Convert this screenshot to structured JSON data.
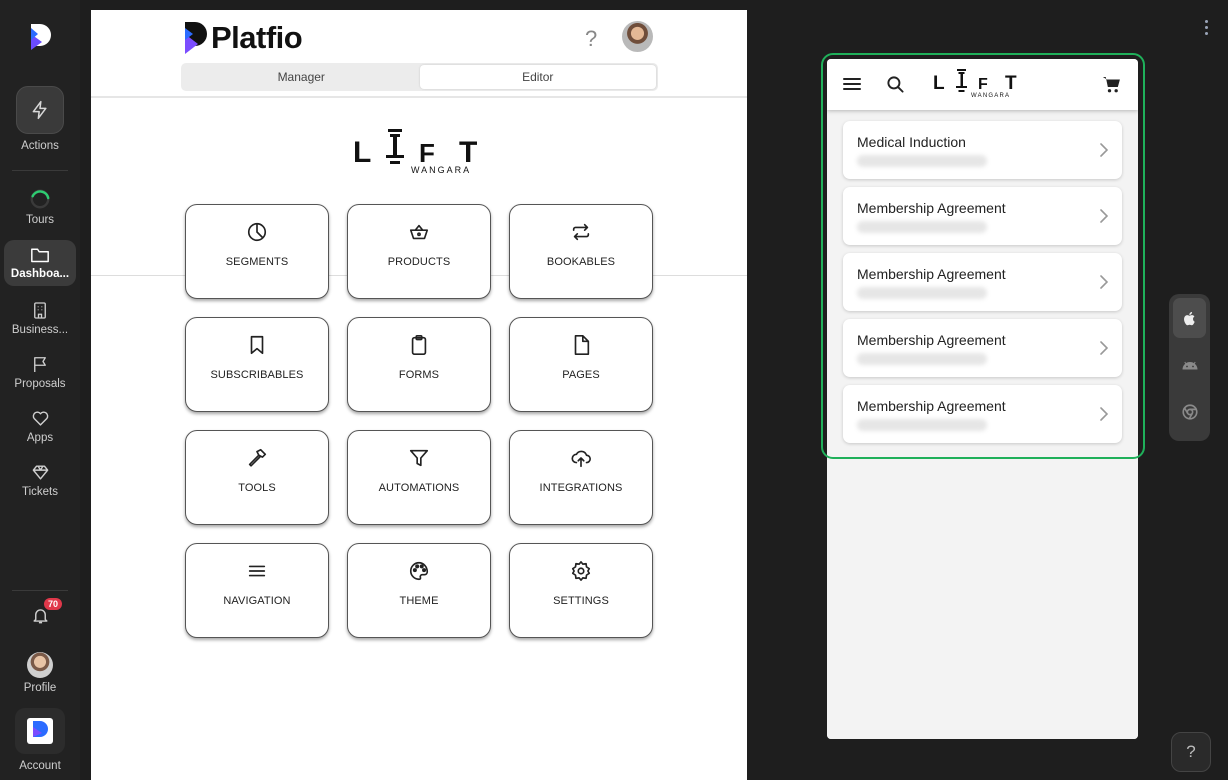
{
  "sidebar": {
    "items": [
      {
        "label": "Actions",
        "icon": "lightning-icon"
      },
      {
        "label": "Tours",
        "icon": "progress-ring-icon"
      },
      {
        "label": "Dashboa...",
        "icon": "folder-icon",
        "active": true
      },
      {
        "label": "Business...",
        "icon": "building-icon"
      },
      {
        "label": "Proposals",
        "icon": "flag-icon"
      },
      {
        "label": "Apps",
        "icon": "heart-icon"
      },
      {
        "label": "Tickets",
        "icon": "diamond-icon"
      }
    ],
    "notifications_count": "70",
    "profile_label": "Profile",
    "account_label": "Account"
  },
  "header": {
    "brand": "Platfio",
    "help_glyph": "?",
    "mode_tabs": [
      {
        "label": "Manager",
        "selected": false
      },
      {
        "label": "Editor",
        "selected": true
      }
    ]
  },
  "client_logo": {
    "letters": [
      "L",
      "I",
      "F",
      "T"
    ],
    "subtitle": "WANGARA"
  },
  "tiles": [
    {
      "label": "SEGMENTS",
      "icon": "pie-chart-icon"
    },
    {
      "label": "PRODUCTS",
      "icon": "basket-icon"
    },
    {
      "label": "BOOKABLES",
      "icon": "repeat-icon"
    },
    {
      "label": "SUBSCRIBABLES",
      "icon": "bookmark-icon"
    },
    {
      "label": "FORMS",
      "icon": "clipboard-icon"
    },
    {
      "label": "PAGES",
      "icon": "file-icon"
    },
    {
      "label": "TOOLS",
      "icon": "hammer-icon"
    },
    {
      "label": "AUTOMATIONS",
      "icon": "filter-icon"
    },
    {
      "label": "INTEGRATIONS",
      "icon": "cloud-upload-icon"
    },
    {
      "label": "NAVIGATION",
      "icon": "menu-icon"
    },
    {
      "label": "THEME",
      "icon": "palette-icon"
    },
    {
      "label": "SETTINGS",
      "icon": "gear-icon"
    }
  ],
  "preview": {
    "cards": [
      {
        "title": "Medical Induction"
      },
      {
        "title": "Membership Agreement"
      },
      {
        "title": "Membership Agreement"
      },
      {
        "title": "Membership Agreement"
      },
      {
        "title": "Membership Agreement"
      }
    ],
    "platforms": [
      "apple-icon",
      "android-icon",
      "chrome-icon"
    ]
  },
  "help_button": "?",
  "colors": {
    "accent_green": "#1fb05a",
    "badge_red": "#e0384a",
    "brand_purple": "#7b4dff",
    "brand_blue": "#2d6cff"
  }
}
